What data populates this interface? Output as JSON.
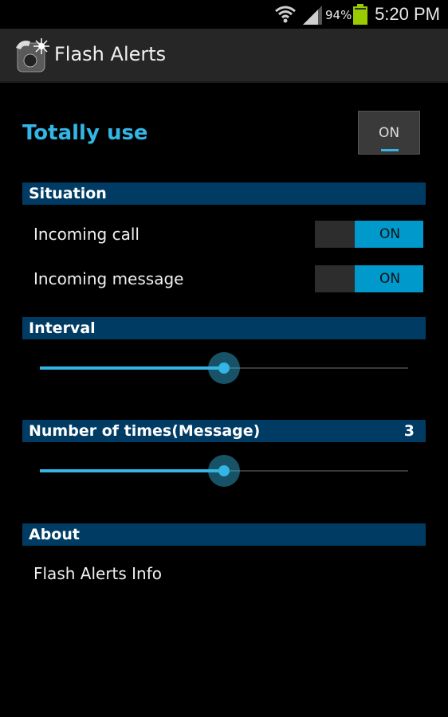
{
  "status_bar": {
    "battery_pct": "94%",
    "time": "5:20 PM",
    "icons": [
      "wifi-icon",
      "signal-icon",
      "battery-icon"
    ]
  },
  "action_bar": {
    "title": "Flash Alerts",
    "icon": "flash-phone-app-icon"
  },
  "main": {
    "totally_use_label": "Totally use",
    "master_toggle_label": "ON",
    "situation": {
      "header": "Situation",
      "items": [
        {
          "label": "Incoming call",
          "switch_label": "ON"
        },
        {
          "label": "Incoming message",
          "switch_label": "ON"
        }
      ]
    },
    "interval": {
      "header": "Interval",
      "slider_fraction": 0.5
    },
    "number_of_times": {
      "header": "Number of times(Message)",
      "value": "3",
      "slider_fraction": 0.5
    },
    "about": {
      "header": "About",
      "info_label": "Flash Alerts Info"
    }
  },
  "colors": {
    "accent": "#33b5e5",
    "section_bg": "#003b63",
    "switch_on": "#0099cc",
    "action_bar": "#262626"
  }
}
